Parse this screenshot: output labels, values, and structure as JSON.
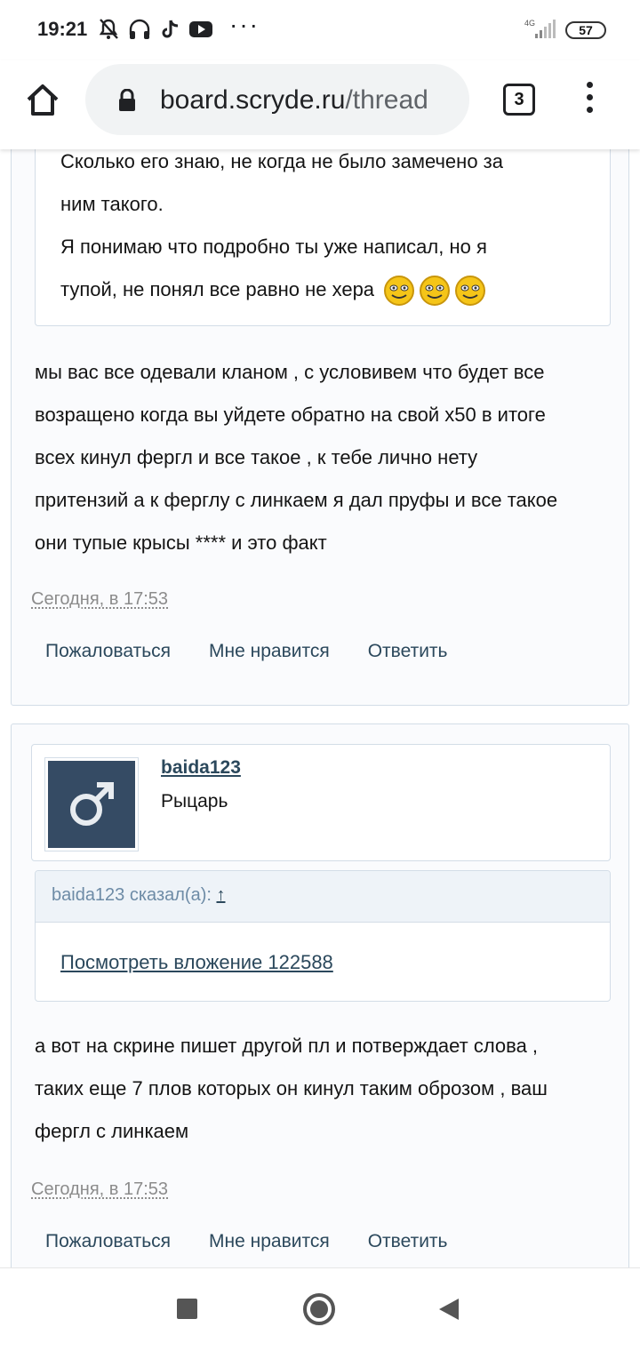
{
  "status_bar": {
    "time": "19:21",
    "dots": "···",
    "network": "4G",
    "battery": "57"
  },
  "browser": {
    "url_domain": "board.scryde.ru",
    "url_path": "/thread",
    "tab_count": "3"
  },
  "post1": {
    "quote_lines": [
      "Сколько его знаю, не когда не было замечено за",
      "ним такого.",
      "Я понимаю что подробно ты уже написал, но я",
      "тупой, не понял все равно не хера"
    ],
    "body_lines": [
      "мы вас все одевали кланом , с условивем что будет все",
      "возращено когда вы уйдете обратно на свой х50 в итоге",
      "всех кинул фергл и все такое , к тебе лично нету",
      "притензий а к ферглу с линкаем я дал пруфы и все такое",
      "они тупые крысы **** и это факт"
    ],
    "date": "Сегодня, в 17:53",
    "actions": {
      "report": "Пожаловаться",
      "like": "Мне нравится",
      "reply": "Ответить"
    }
  },
  "post2": {
    "username": "baida123",
    "user_title": "Рыцарь",
    "quote_author": "baida123 сказал(а):",
    "quote_arrow": "↑",
    "attachment_link": "Посмотреть вложение 122588",
    "body_lines": [
      "а вот на скрине пишет другой пл и потверждает слова ,",
      "таких еще 7 плов которых он кинул таким оброзом , ваш",
      "фергл с линкаем"
    ],
    "date": "Сегодня, в 17:53",
    "actions": {
      "report": "Пожаловаться",
      "like": "Мне нравится",
      "reply": "Ответить"
    }
  },
  "icons": {
    "home": "home-icon",
    "lock": "lock-icon",
    "menu": "more-vert-icon",
    "avatar": "male-symbol-icon",
    "smiley": "smiley-icon"
  },
  "colors": {
    "link": "#2b485c",
    "border": "#d3dde7",
    "avatar_bg": "#354b64",
    "date": "#8c8c8c"
  }
}
